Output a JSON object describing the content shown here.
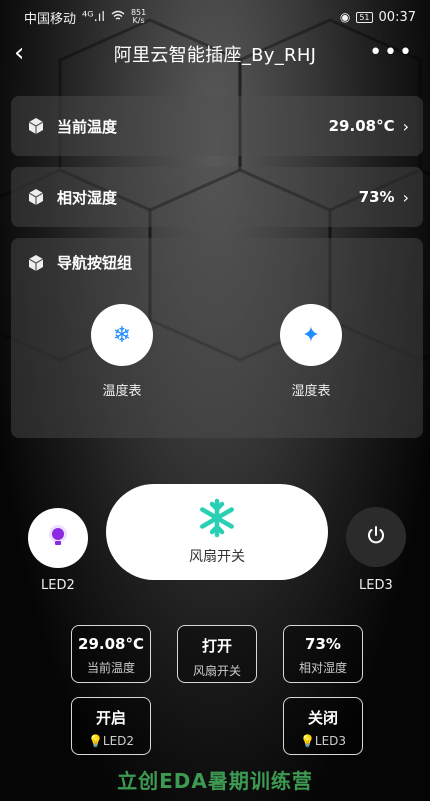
{
  "status": {
    "carrier": "中国移动",
    "signal": "⁴ᴳ.ıl",
    "net_speed_top": "851",
    "net_speed_bottom": "K/s",
    "battery": "51",
    "time": "00:37"
  },
  "nav": {
    "back_icon": "‹",
    "title": "阿里云智能插座_By_RHJ",
    "more_icon": "•••"
  },
  "cards": {
    "temperature": {
      "label": "当前温度",
      "value": "29.08°C",
      "arrow": "›"
    },
    "humidity": {
      "label": "相对湿度",
      "value": "73%",
      "arrow": "›"
    },
    "nav_group": {
      "label": "导航按钮组",
      "buttons": [
        {
          "icon": "snowflake-icon",
          "glyph": "❄",
          "caption": "温度表"
        },
        {
          "icon": "sparkle-icon",
          "glyph": "✦",
          "caption": "湿度表"
        }
      ]
    }
  },
  "controls": {
    "led2_label": "LED2",
    "led3_label": "LED3",
    "fan_label": "风扇开关"
  },
  "tiles": {
    "temp": {
      "value": "29.08°C",
      "label": "当前温度"
    },
    "fan": {
      "value": "打开",
      "label": "风扇开关"
    },
    "hum": {
      "value": "73%",
      "label": "相对湿度"
    },
    "led2": {
      "value": "开启",
      "label": "LED2"
    },
    "led3": {
      "value": "关闭",
      "label": "LED3"
    }
  },
  "footer": "立创EDA暑期训练营",
  "colors": {
    "accent_blue": "#1f8cff",
    "fan_teal": "#2ad0b4",
    "bulb_purple": "#8a2be2",
    "footer_green": "#3d9a52"
  }
}
